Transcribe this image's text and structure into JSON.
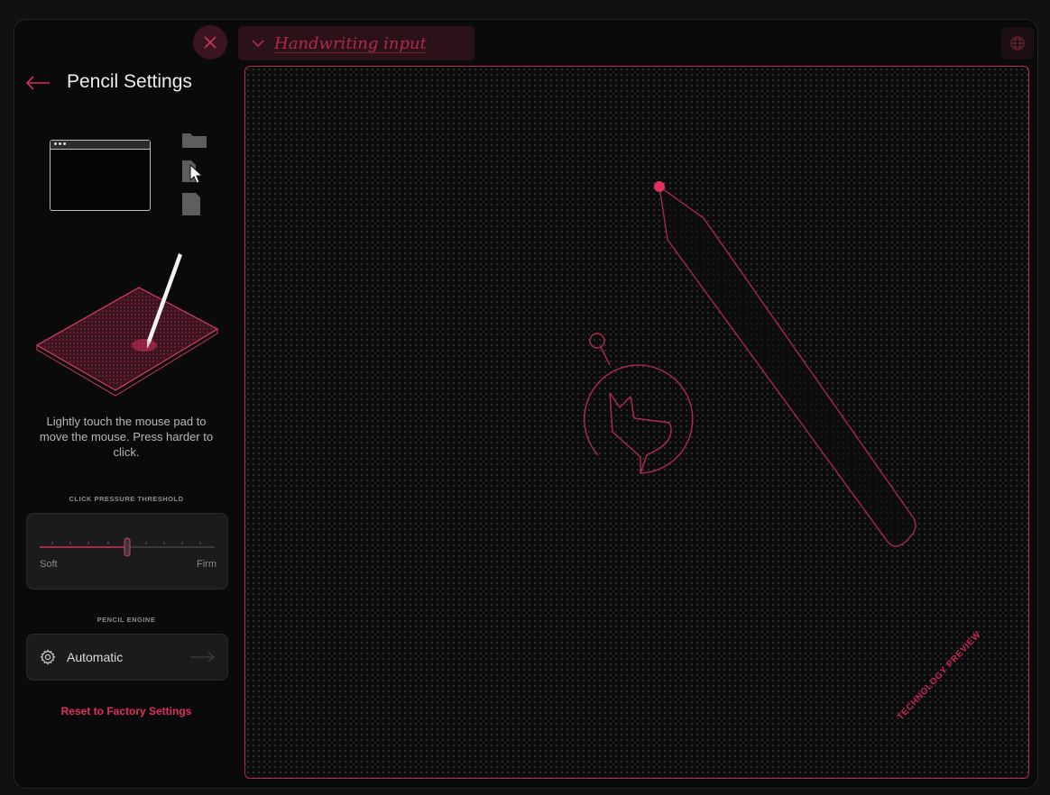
{
  "toolbar": {
    "close_icon": "close-icon",
    "handwriting_placeholder": "Handwriting input",
    "globe_icon": "globe-icon"
  },
  "panel": {
    "title": "Pencil Settings",
    "back_icon": "arrow-left-icon",
    "help_text": "Lightly touch the mouse pad to move the mouse. Press harder to click.",
    "pressure": {
      "label": "CLICK PRESSURE THRESHOLD",
      "min_label": "Soft",
      "max_label": "Firm",
      "value_fraction": 0.5
    },
    "engine": {
      "label": "PENCIL ENGINE",
      "value": "Automatic",
      "icon": "gear-icon"
    },
    "reset_label": "Reset to Factory Settings"
  },
  "canvas": {
    "watermark": "TECHNOLOGY PREVIEW"
  },
  "colors": {
    "accent": "#e0305f",
    "accent_dark": "#b02a4d",
    "background": "#0a0a0b",
    "card": "#1b1b1d"
  }
}
